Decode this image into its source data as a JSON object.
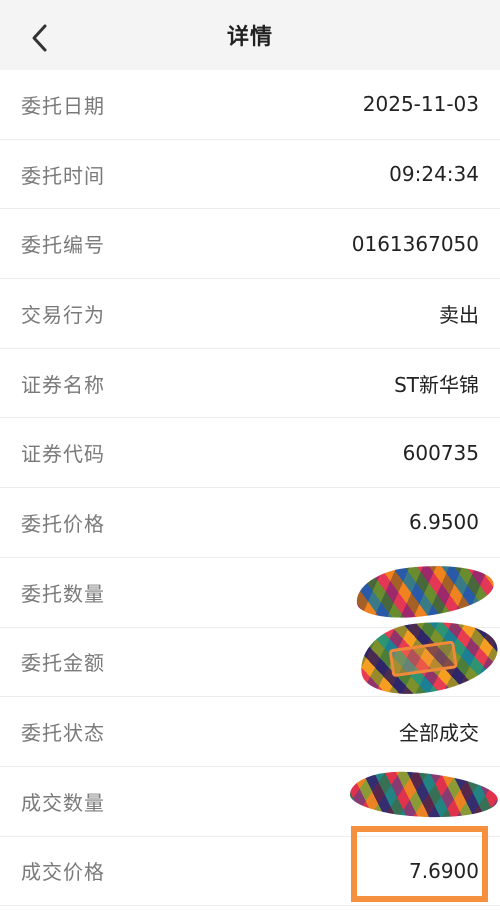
{
  "header": {
    "title": "详情",
    "back_icon": "chevron-left-icon"
  },
  "rows": [
    {
      "label": "委托日期",
      "value": "2025-11-03"
    },
    {
      "label": "委托时间",
      "value": "09:24:34"
    },
    {
      "label": "委托编号",
      "value": "0161367050"
    },
    {
      "label": "交易行为",
      "value": "卖出"
    },
    {
      "label": "证券名称",
      "value": "ST新华锦"
    },
    {
      "label": "证券代码",
      "value": "600735"
    },
    {
      "label": "委托价格",
      "value": "6.9500"
    },
    {
      "label": "委托数量",
      "value": ""
    },
    {
      "label": "委托金额",
      "value": ""
    },
    {
      "label": "委托状态",
      "value": "全部成交"
    },
    {
      "label": "成交数量",
      "value": ""
    },
    {
      "label": "成交价格",
      "value": "7.6900"
    }
  ],
  "colors": {
    "highlight": "#f5913e",
    "header_bg": "#f4f4f4",
    "label": "#7a7a7a",
    "value": "#222222"
  }
}
